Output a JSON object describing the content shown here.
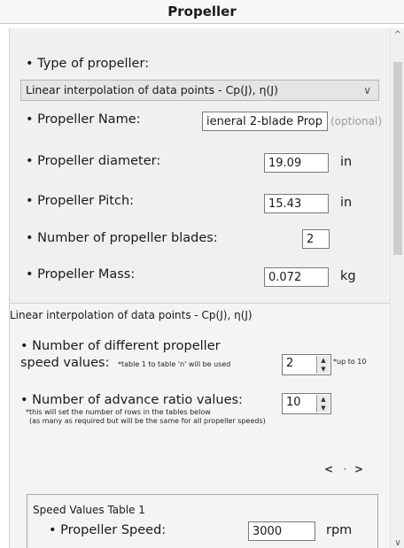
{
  "header": {
    "title": "Propeller"
  },
  "propeller": {
    "type_label": "• Type of propeller:",
    "type_value": "Linear interpolation of data points - Cp(J), η(J)",
    "name_label": "• Propeller Name:",
    "name_value": "ieneral 2-blade Prop",
    "name_hint": "(optional)",
    "diameter_label": "• Propeller diameter:",
    "diameter_value": "19.09",
    "diameter_unit": "in",
    "pitch_label": "• Propeller Pitch:",
    "pitch_value": "15.43",
    "pitch_unit": "in",
    "blades_label": "• Number of propeller blades:",
    "blades_value": "2",
    "mass_label": "• Propeller Mass:",
    "mass_value": "0.072",
    "mass_unit": "kg"
  },
  "linear": {
    "section_title": "Linear interpolation of data points - Cp(J), η(J)",
    "speed_label_1": "• Number of different propeller",
    "speed_label_2": "speed values:",
    "speed_note": "*table 1 to table 'n' will be used",
    "speed_value": "2",
    "speed_hint": "*up to 10",
    "advance_label": "• Number of advance ratio values:",
    "advance_value": "10",
    "advance_note_1": "*this will set the number of rows in the tables below",
    "advance_note_2": "(as many as required but will be the same for all propeller speeds)",
    "nav_prev": "<",
    "nav_next": ">",
    "table_title": "Speed Values Table 1",
    "prop_speed_label": "• Propeller Speed:",
    "prop_speed_value": "3000",
    "prop_speed_unit": "rpm"
  },
  "icons": {
    "combo": "chevron-down-icon",
    "scroll_up": "scroll-up-icon",
    "scroll_down": "scroll-down-icon"
  }
}
